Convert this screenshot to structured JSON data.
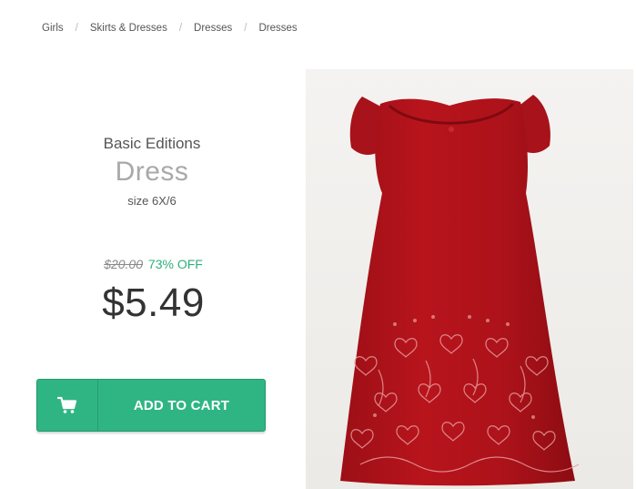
{
  "breadcrumb": {
    "items": [
      "Girls",
      "Skirts & Dresses",
      "Dresses",
      "Dresses"
    ],
    "separator": "/"
  },
  "product": {
    "brand": "Basic Editions",
    "title": "Dress",
    "size": "size 6X/6",
    "original_price": "$20.00",
    "discount": "73% OFF",
    "price": "$5.49",
    "image_icon": "red-dress-photo"
  },
  "cart_button": {
    "label": "ADD TO CART",
    "icon": "cart-icon"
  },
  "colors": {
    "accent": "#2fb584",
    "discount": "#2fae7d",
    "dress": "#b0121a"
  }
}
